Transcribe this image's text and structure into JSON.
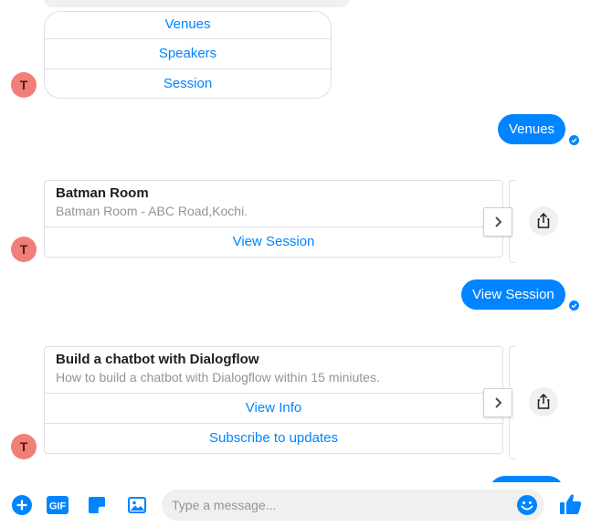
{
  "quick_replies": [
    "Venues",
    "Speakers",
    "Session"
  ],
  "avatar_letter": "T",
  "sent_venues": "Venues",
  "card_venue": {
    "title": "Batman Room",
    "subtitle": "Batman Room - ABC Road,Kochi.",
    "button": "View Session"
  },
  "sent_view_session": "View Session",
  "card_session": {
    "title": "Build a chatbot with Dialogflow",
    "subtitle": "How to build a chatbot with Dialogflow within 15 miniutes.",
    "buttons": [
      "View Info",
      "Subscribe to updates"
    ]
  },
  "composer": {
    "placeholder": "Type a message...",
    "gif_label": "GIF"
  },
  "colors": {
    "accent": "#0084ff",
    "avatar": "#f07f78",
    "border": "#dddfe2"
  },
  "icons": [
    "plus-icon",
    "gif-icon",
    "sticker-icon",
    "image-icon",
    "emoji-icon",
    "thumbs-up-icon",
    "chevron-right-icon",
    "share-icon",
    "checkmark-icon"
  ]
}
